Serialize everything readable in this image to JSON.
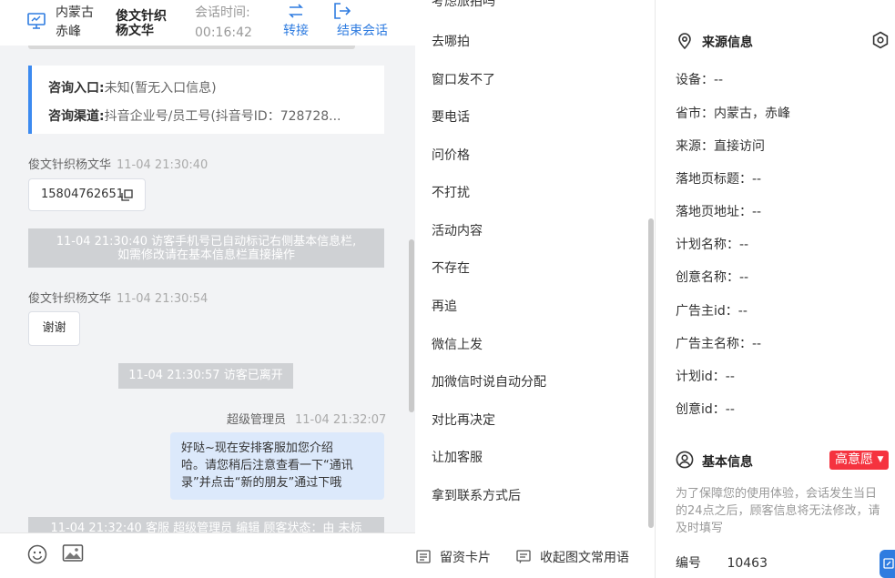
{
  "header": {
    "location_line1": "内蒙古",
    "location_line2": "赤峰",
    "agent_line1": "俊文针织",
    "agent_line2": "杨文华",
    "session_label": "会话时间:",
    "session_time": "00:16:42",
    "transfer_label": "转接",
    "end_label": "结束会话"
  },
  "info_card": {
    "entry_label": "咨询入口:",
    "entry_value": "未知(暂无入口信息)",
    "channel_label": "咨询渠道:",
    "channel_value": "抖音企业号/员工号(抖音号ID：728728..."
  },
  "messages": {
    "m1_sender": "俊文针织杨文华",
    "m1_time": "11-04 21:30:40",
    "m1_text": "15804762651",
    "sys1_line1": "11-04 21:30:40 访客手机号已自动标记右侧基本信息栏,",
    "sys1_line2": "如需修改请在基本信息栏直接操作",
    "m2_sender": "俊文针织杨文华",
    "m2_time": "11-04 21:30:54",
    "m2_text": "谢谢",
    "sys2": "11-04 21:30:57 访客已离开",
    "m3_sender": "超级管理员",
    "m3_time": "11-04 21:32:07",
    "m3_line1": "好哒~现在安排客服加您介绍",
    "m3_line2": "哈。请您稍后注意查看一下“通讯",
    "m3_line3": "录”并点击“新的朋友”通过下哦",
    "sys3": "11-04 21:32:40 客服 超级管理员 编辑 顾客状态：由 未标"
  },
  "phrases": [
    "考虑旅拍吗",
    "去哪拍",
    "窗口发不了",
    "要电话",
    "问价格",
    "不打扰",
    "活动内容",
    "不存在",
    "再追",
    "微信上发",
    "加微信时说自动分配",
    "对比再决定",
    "让加客服",
    "拿到联系方式后"
  ],
  "footer": {
    "card_label": "留资卡片",
    "collapse_label": "收起图文常用语"
  },
  "source_info": {
    "title": "来源信息",
    "fields": [
      "设备：--",
      "省市：内蒙古，赤峰",
      "来源：直接访问",
      "落地页标题：--",
      "落地页地址：--",
      "计划名称：--",
      "创意名称：--",
      "广告主id：--",
      "广告主名称：--",
      "计划id：--",
      "创意id：--"
    ]
  },
  "basic_info": {
    "title": "基本信息",
    "intent_tag": "高意愿",
    "tip": "为了保障您的使用体验，会话发生当日的24点之后，顾客信息将无法修改，请及时填写",
    "number_label": "编号",
    "number_value": "10463"
  },
  "colors": {
    "accent": "#2f7ce0",
    "tag_red": "#f5333f",
    "chat_bg": "#f2f3f5",
    "my_bubble": "#dce9fb"
  }
}
